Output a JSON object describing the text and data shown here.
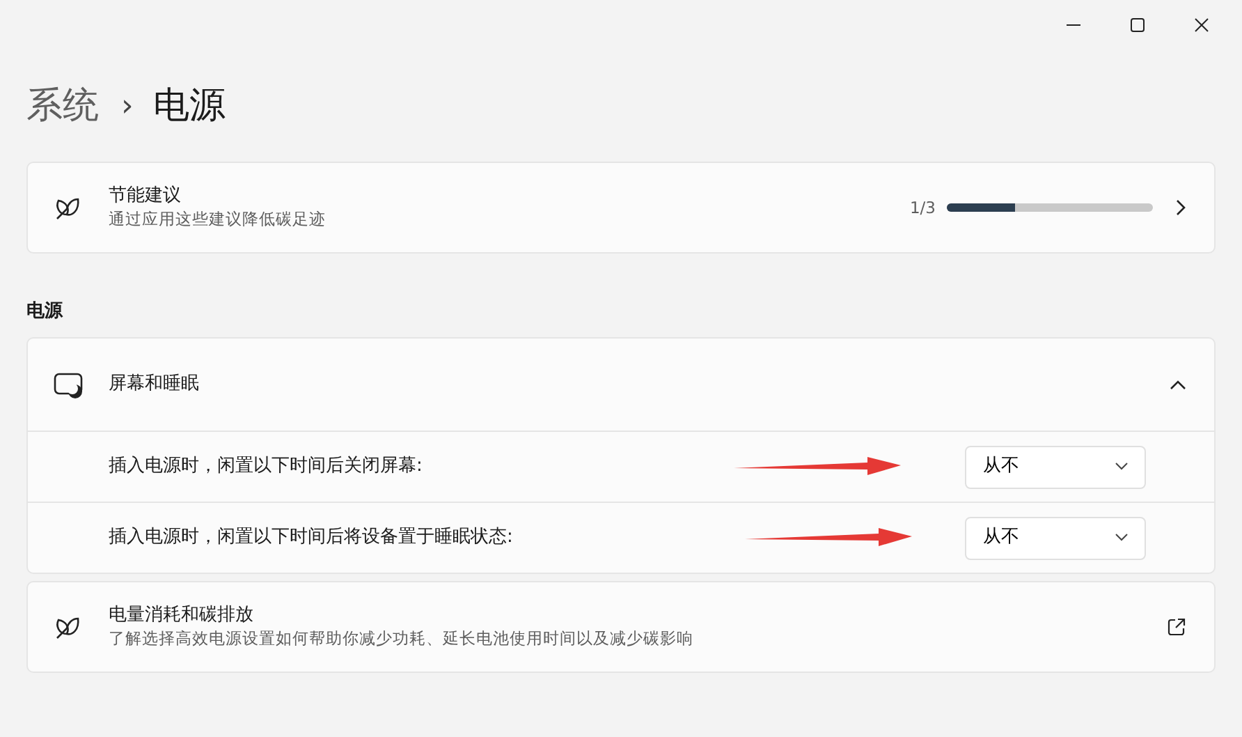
{
  "window": {
    "controls": [
      {
        "kind": "minimize"
      },
      {
        "kind": "maximize"
      },
      {
        "kind": "close"
      }
    ]
  },
  "breadcrumb": {
    "parent": "系统",
    "separator": "›",
    "current": "电源"
  },
  "recommendations": {
    "title": "节能建议",
    "subtitle": "通过应用这些建议降低碳足迹",
    "count": "1/3",
    "level": 0.33
  },
  "section_title": "电源",
  "screen_sleep": {
    "title": "屏幕和睡眠",
    "expanded": true,
    "settings": [
      {
        "label": "插入电源时，闲置以下时间后关闭屏幕:",
        "value": "从不",
        "arrow": true
      },
      {
        "label": "插入电源时，闲置以下时间后将设备置于睡眠状态:",
        "value": "从不",
        "arrow": true
      }
    ]
  },
  "energy": {
    "title": "电量消耗和碳排放",
    "subtitle": "了解选择高效电源设置如何帮助你减少功耗、延长电池使用时间以及减少碳影响"
  }
}
